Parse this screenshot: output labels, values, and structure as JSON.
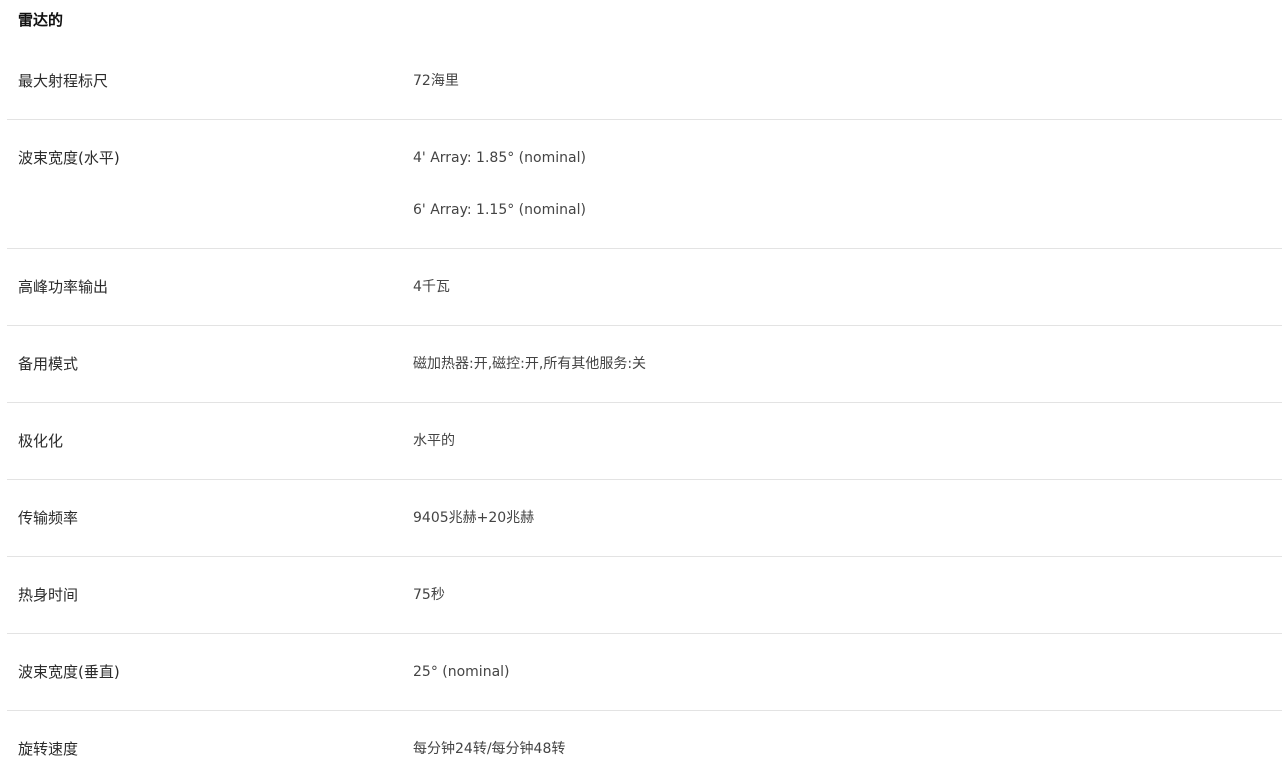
{
  "section": {
    "title": "雷达的"
  },
  "specs": [
    {
      "label": "最大射程标尺",
      "values": [
        "72海里"
      ]
    },
    {
      "label": "波束宽度(水平)",
      "values": [
        "4' Array: 1.85° (nominal)",
        "6' Array: 1.15° (nominal)"
      ]
    },
    {
      "label": "高峰功率输出",
      "values": [
        "4千瓦"
      ]
    },
    {
      "label": "备用模式",
      "values": [
        "磁加热器:开,磁控:开,所有其他服务:关"
      ]
    },
    {
      "label": "极化化",
      "values": [
        "水平的"
      ]
    },
    {
      "label": "传输频率",
      "values": [
        "9405兆赫+20兆赫"
      ]
    },
    {
      "label": "热身时间",
      "values": [
        "75秒"
      ]
    },
    {
      "label": "波束宽度(垂直)",
      "values": [
        "25° (nominal)"
      ]
    },
    {
      "label": "旋转速度",
      "values": [
        "每分钟24转/每分钟48转"
      ]
    }
  ]
}
